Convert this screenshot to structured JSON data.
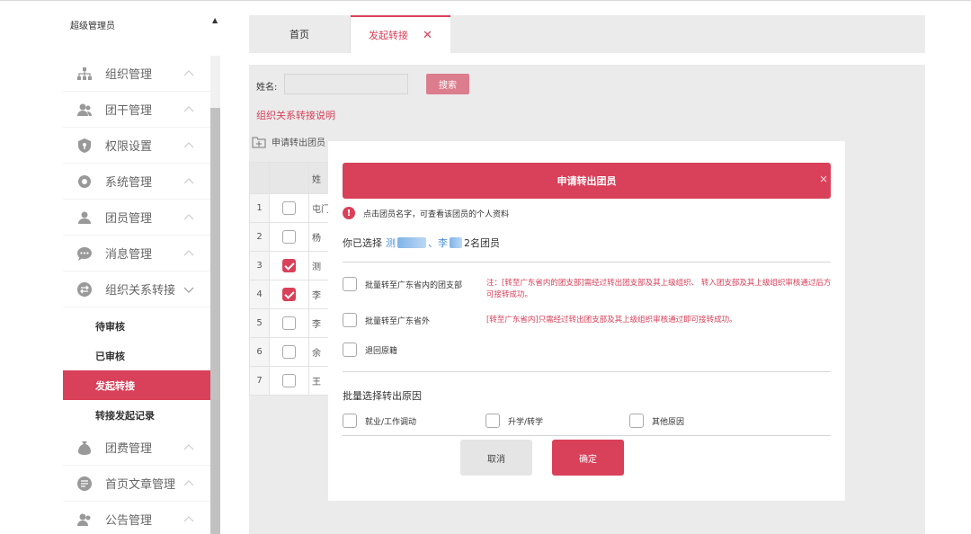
{
  "user": {
    "name": "超级管理员"
  },
  "sidebar": {
    "menus": [
      {
        "label": "组织管理",
        "icon": "org-chart-icon"
      },
      {
        "label": "团干管理",
        "icon": "users-icon"
      },
      {
        "label": "权限设置",
        "icon": "shield-icon"
      },
      {
        "label": "系统管理",
        "icon": "gear-icon"
      },
      {
        "label": "团员管理",
        "icon": "group-icon"
      },
      {
        "label": "消息管理",
        "icon": "chat-bubble-icon"
      },
      {
        "label": "组织关系转接",
        "icon": "transfer-icon"
      },
      {
        "label": "团费管理",
        "icon": "money-bag-icon"
      },
      {
        "label": "首页文章管理",
        "icon": "article-icon"
      },
      {
        "label": "公告管理",
        "icon": "users-icon"
      }
    ],
    "submenu": [
      "待审核",
      "已审核",
      "发起转接",
      "转接发起记录"
    ]
  },
  "tabs": {
    "home": "首页",
    "active": "发起转接"
  },
  "search": {
    "label": "姓名:",
    "button": "搜索"
  },
  "explain_link": "组织关系转接说明",
  "apply_label": "申请转出团员",
  "table": {
    "header": "姓",
    "rows": [
      {
        "idx": "1",
        "name": "屯门",
        "checked": false
      },
      {
        "idx": "2",
        "name": "杨",
        "checked": false
      },
      {
        "idx": "3",
        "name": "测",
        "checked": true
      },
      {
        "idx": "4",
        "name": "李",
        "checked": true
      },
      {
        "idx": "5",
        "name": "李",
        "checked": false
      },
      {
        "idx": "6",
        "name": "余",
        "checked": false
      },
      {
        "idx": "7",
        "name": "王",
        "checked": false
      }
    ]
  },
  "modal": {
    "title": "申请转出团员",
    "close": "×",
    "tip_icon": "!",
    "tip": "点击团员名字，可查看该团员的个人资料",
    "chosen_prefix": "你已选择",
    "chosen_name1": "测",
    "chosen_sep": "、",
    "chosen_name2": "李",
    "chosen_suffix": "2名团员",
    "options": [
      "批量转至广东省内的团支部",
      "批量转至广东省外",
      "退回原籍"
    ],
    "note1": "注：[转至广东省内的团支部]需经过转出团支部及其上级组织、 转入团支部及其上级组织审核通过后方可接转成功。",
    "note2": "[转至广东省内]只需经过转出团支部及其上级组织审核通过即可接转成功。",
    "reason_title": "批量选择转出原因",
    "reasons": [
      "就业/工作调动",
      "升学/转学",
      "其他原因"
    ],
    "cancel": "取消",
    "confirm": "确定"
  },
  "colors": {
    "accent": "#d94059",
    "link": "#4a8fd8"
  }
}
